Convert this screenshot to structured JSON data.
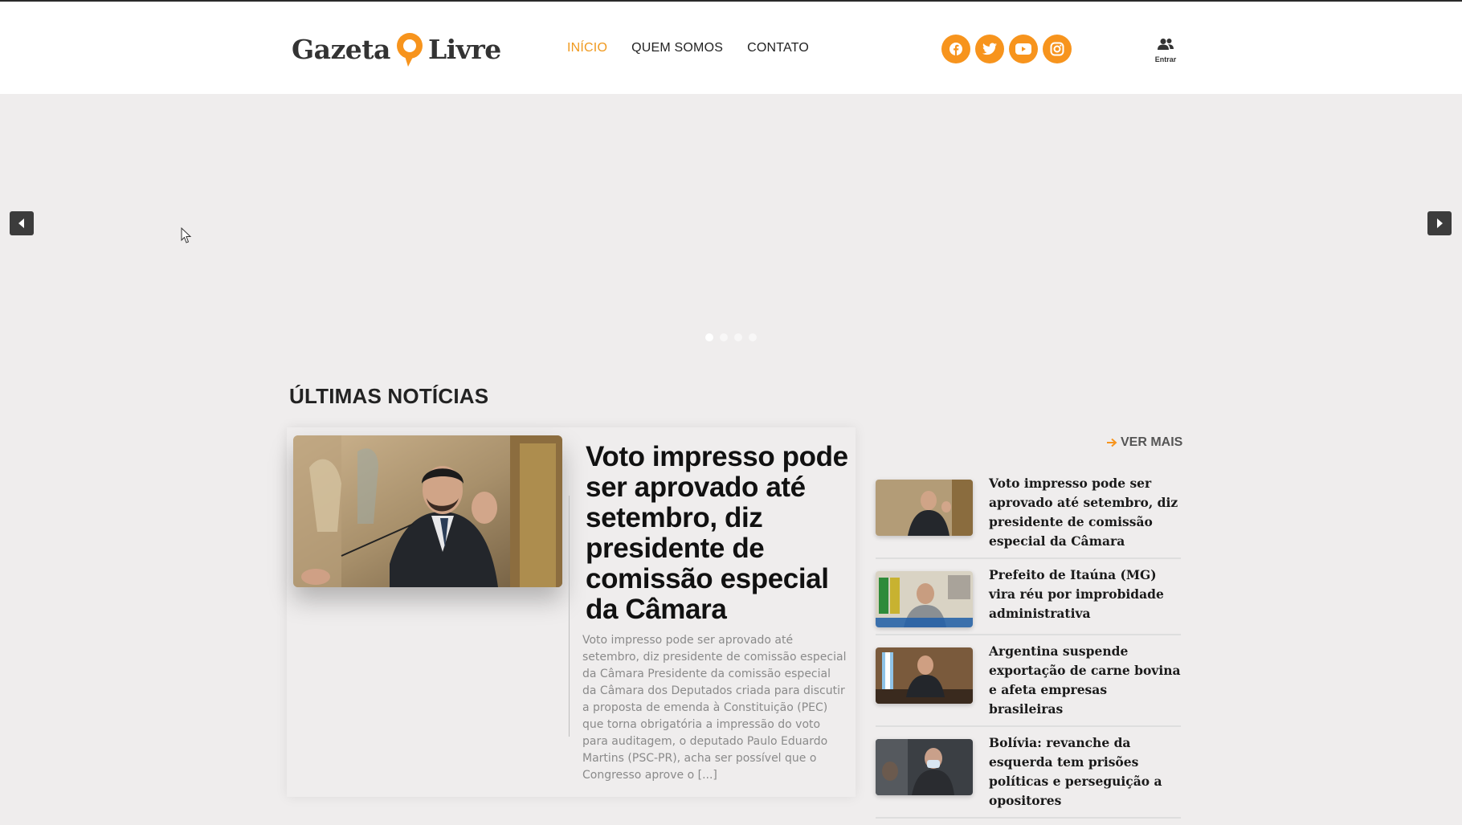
{
  "header": {
    "logo": {
      "left_text": "Gazeta",
      "right_text": "Livre"
    },
    "nav": [
      {
        "label": "INÍCIO",
        "active": true
      },
      {
        "label": "QUEM SOMOS",
        "active": false
      },
      {
        "label": "CONTATO",
        "active": false
      }
    ],
    "social": [
      "facebook-icon",
      "twitter-icon",
      "youtube-icon",
      "instagram-icon"
    ],
    "login_label": "Entrar"
  },
  "slider": {
    "slides": 4,
    "active_slide": 1
  },
  "section_title": "ÚLTIMAS NOTÍCIAS",
  "featured": {
    "title": "Voto impresso pode ser aprovado até setembro, diz presidente de comissão especial da Câmara",
    "excerpt": "Voto impresso pode ser aprovado até setembro, diz presidente de comissão especial da Câmara Presidente da comissão especial da Câmara dos Deputados criada para discutir a proposta de emenda à Constituição (PEC) que torna obrigatória a impressão do voto para auditagem, o deputado Paulo Eduardo Martins (PSC-PR), acha ser possível que o Congresso aprove o [...]"
  },
  "ver_mais": "VER MAIS",
  "side_news": [
    {
      "title": "Voto impresso pode ser aprovado até setembro, diz presidente de comissão especial da Câmara"
    },
    {
      "title": "Prefeito de Itaúna (MG) vira réu por improbidade administrativa"
    },
    {
      "title": "Argentina suspende exportação de carne bovina e afeta empresas brasileiras"
    },
    {
      "title": "Bolívia: revanche da esquerda tem prisões políticas e perseguição a opositores"
    }
  ],
  "colors": {
    "accent": "#f7941d",
    "page_bg": "#efeded",
    "header_bg": "#ffffff"
  }
}
